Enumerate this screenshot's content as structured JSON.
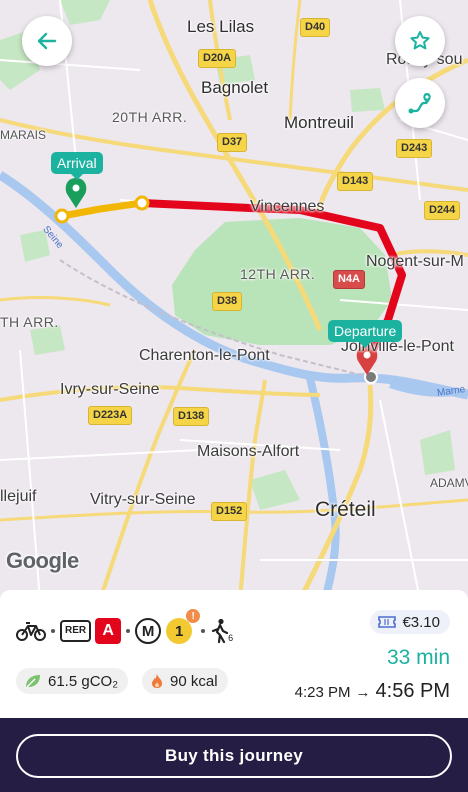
{
  "map": {
    "places": {
      "les_lilas": "Les Lilas",
      "bagnolet": "Bagnolet",
      "rosny": "Rosny-sou",
      "arr20": "20TH ARR.",
      "montreuil": "Montreuil",
      "marais": "MARAIS",
      "vincennes": "Vincennes",
      "arr12": "12TH ARR.",
      "nogent": "Nogent-sur-M",
      "arr13": "TH ARR.",
      "charenton": "Charenton-le-Pont",
      "joinville": "Joinville-le-Pont",
      "ivry": "Ivry-sur-Seine",
      "maisons": "Maisons-Alfort",
      "villejuif": "llejuif",
      "vitry": "Vitry-sur-Seine",
      "creteil": "Créteil",
      "adamville": "ADAMV",
      "seine": "Seine",
      "marne": "Marne"
    },
    "roads": {
      "d40": "D40",
      "d20a": "D20A",
      "d37": "D37",
      "d243": "D243",
      "d143": "D143",
      "d244": "D244",
      "n4a": "N4A",
      "d38": "D38",
      "d223a": "D223A",
      "d138": "D138",
      "d152": "D152"
    },
    "arrival_label": "Arrival",
    "departure_label": "Departure",
    "attribution": "Google",
    "route_colors": {
      "rer_a": "#e3051c",
      "metro_1": "#f2c931",
      "accent": "#1bb3a0"
    }
  },
  "controls": {
    "back_icon": "arrow-left-icon",
    "favorite_icon": "star-outline-icon",
    "route_view_icon": "route-map-icon"
  },
  "journey": {
    "modes": {
      "bike_icon": "bicycle-icon",
      "rer_label": "RER",
      "rer_line": "A",
      "metro_label": "M",
      "metro_line": "1",
      "alert_symbol": "!",
      "walk_icon": "walk-icon",
      "walk_minutes": "6"
    },
    "co2": "61.5 gCO₂",
    "calories": "90 kcal",
    "price": "€3.10",
    "duration": "33 min",
    "departure_time": "4:23 PM",
    "arrow": "→",
    "arrival_time": "4:56 PM"
  },
  "footer": {
    "buy_label": "Buy this journey"
  }
}
